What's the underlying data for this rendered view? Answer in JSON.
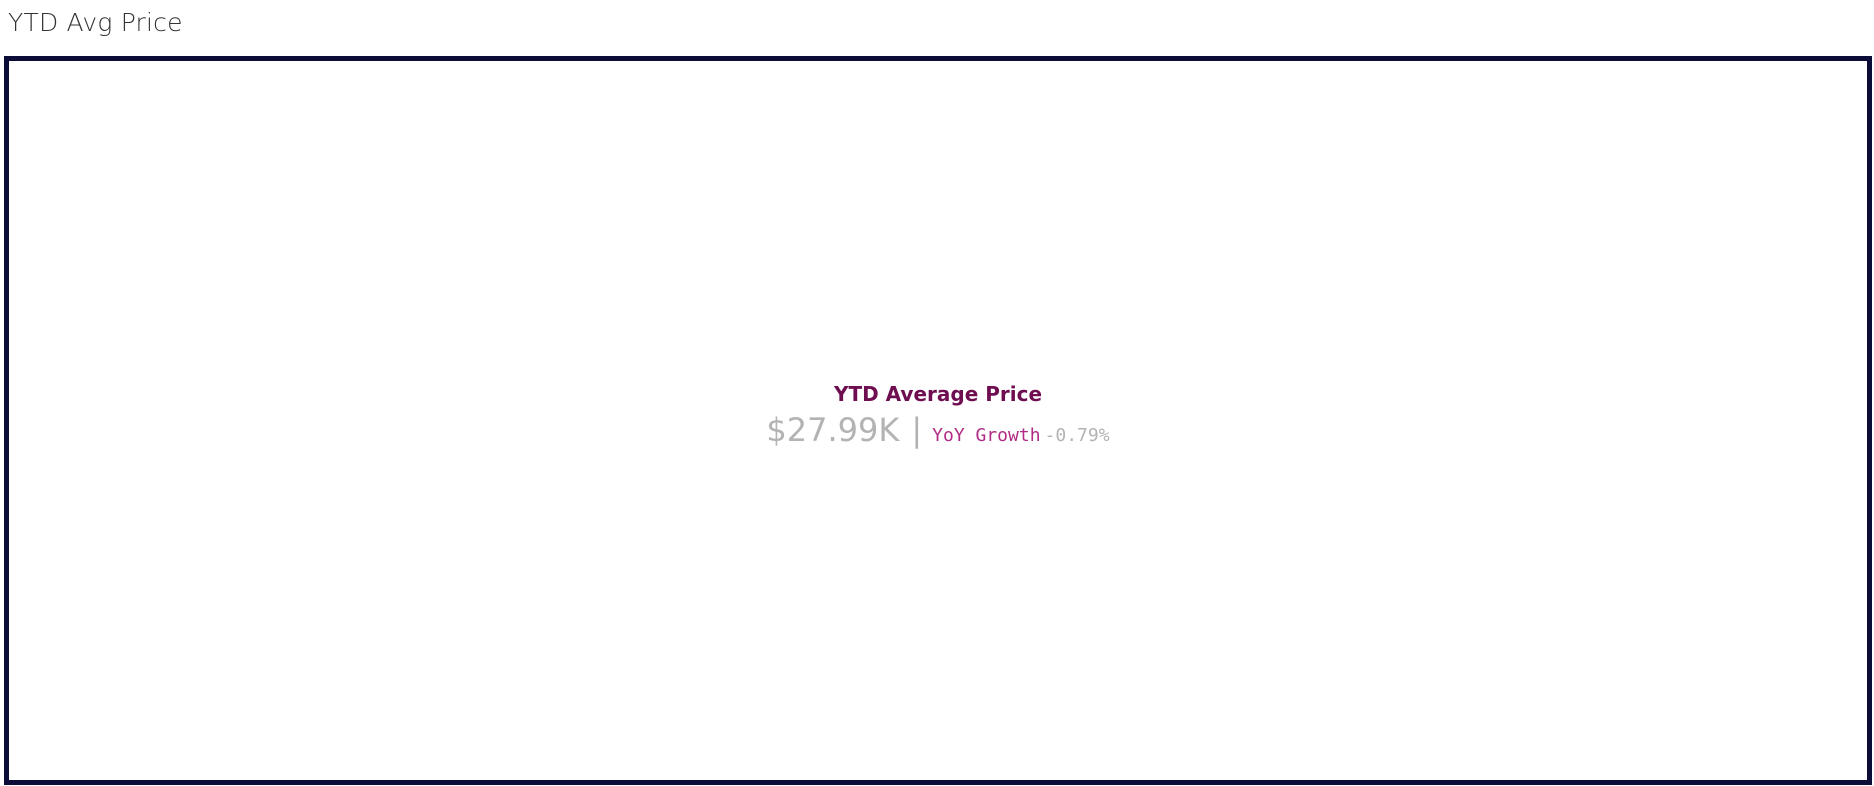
{
  "sheet": {
    "title": "YTD Avg Price"
  },
  "kpi": {
    "title": "YTD Average Price",
    "value": "$27.99K",
    "separator": "|",
    "growth_label": "YoY Growth",
    "growth_value": "-0.79%"
  },
  "colors": {
    "frame_border": "#0c0c38",
    "kpi_title": "#6e0d50",
    "growth_label": "#b02c86",
    "muted_value": "#b3b3b3"
  }
}
